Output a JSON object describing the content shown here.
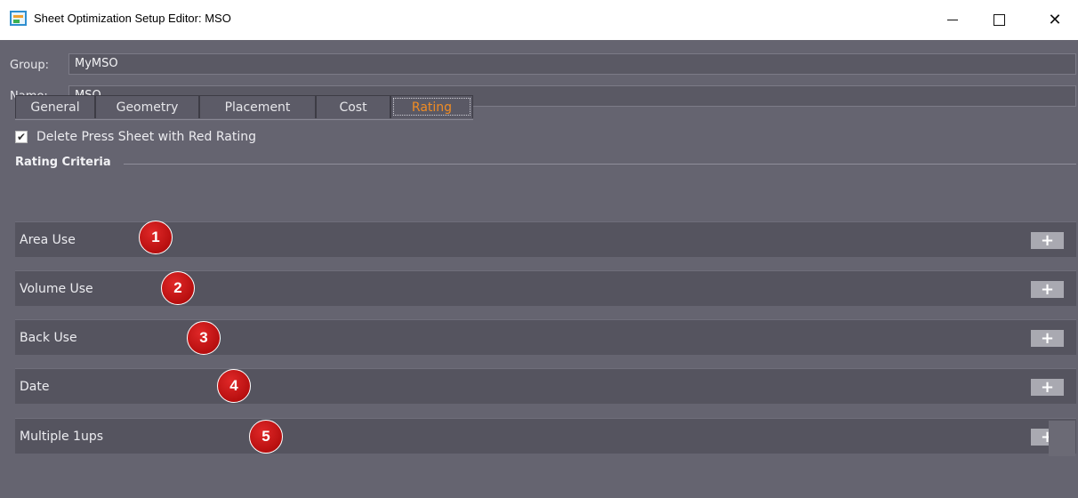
{
  "window": {
    "title": "Sheet Optimization Setup Editor: MSO",
    "minimize": "—",
    "maximize": "",
    "close": "✕"
  },
  "fields": {
    "group_label": "Group:",
    "group_value": "MyMSO",
    "name_label": "Name:",
    "name_value": "MSO"
  },
  "tabs": [
    {
      "label": "General"
    },
    {
      "label": "Geometry"
    },
    {
      "label": "Placement"
    },
    {
      "label": "Cost"
    },
    {
      "label": "Rating",
      "active": true
    }
  ],
  "checkbox": {
    "label": "Delete Press Sheet with Red Rating",
    "checked": true,
    "mark": "✔"
  },
  "section": {
    "title": "Rating Criteria"
  },
  "criteria": [
    {
      "label": "Area Use",
      "badge": "1",
      "add": "+"
    },
    {
      "label": "Volume Use",
      "badge": "2",
      "add": "+"
    },
    {
      "label": "Back Use",
      "badge": "3",
      "add": "+"
    },
    {
      "label": "Date",
      "badge": "4",
      "add": "+"
    },
    {
      "label": "Multiple 1ups",
      "badge": "5",
      "add": "+"
    }
  ],
  "colors": {
    "background": "#656470",
    "active_tab_text": "#f08c24",
    "badge": "#c41414"
  }
}
